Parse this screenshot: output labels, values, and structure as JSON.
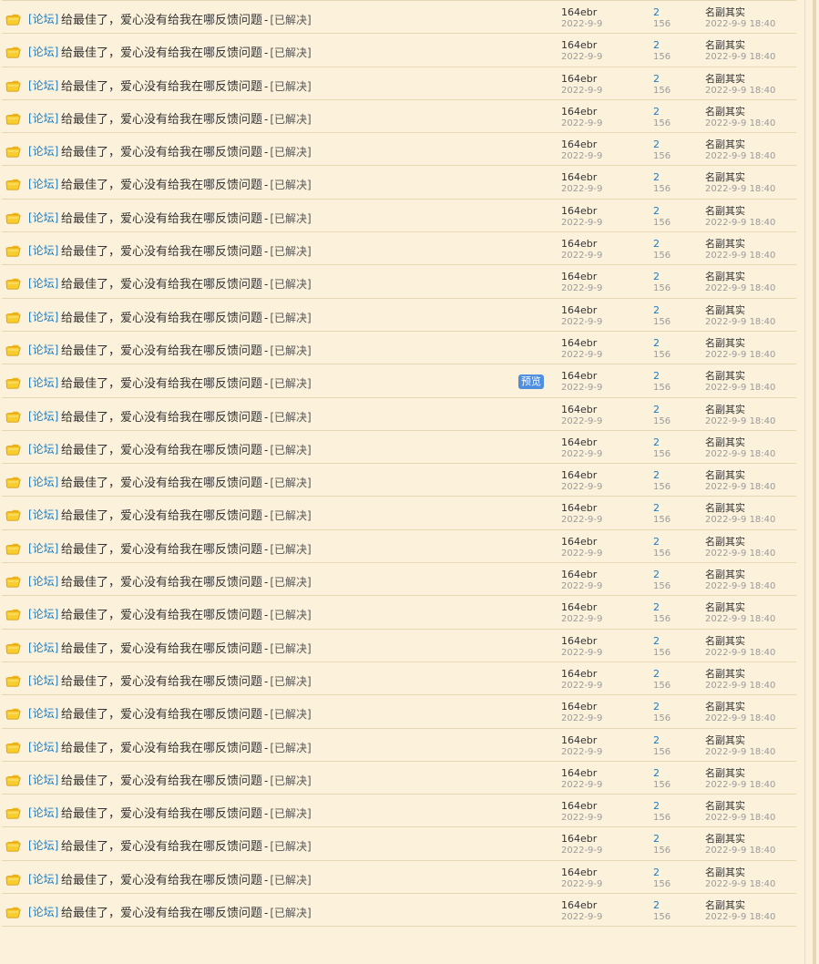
{
  "rows": [
    {
      "forum": "[论坛]",
      "title": "给最佳了，爱心没有给我在哪反馈问题",
      "sep": "-",
      "status": "[已解决]",
      "author": "164ebr",
      "post_date": "2022-9-9",
      "replies": "2",
      "views": "156",
      "last_poster": "名副其实",
      "last_time": "2022-9-9 18:40"
    },
    {
      "forum": "[论坛]",
      "title": "给最佳了，爱心没有给我在哪反馈问题",
      "sep": "-",
      "status": "[已解决]",
      "author": "164ebr",
      "post_date": "2022-9-9",
      "replies": "2",
      "views": "156",
      "last_poster": "名副其实",
      "last_time": "2022-9-9 18:40"
    },
    {
      "forum": "[论坛]",
      "title": "给最佳了，爱心没有给我在哪反馈问题",
      "sep": "-",
      "status": "[已解决]",
      "author": "164ebr",
      "post_date": "2022-9-9",
      "replies": "2",
      "views": "156",
      "last_poster": "名副其实",
      "last_time": "2022-9-9 18:40"
    },
    {
      "forum": "[论坛]",
      "title": "给最佳了，爱心没有给我在哪反馈问题",
      "sep": "-",
      "status": "[已解决]",
      "author": "164ebr",
      "post_date": "2022-9-9",
      "replies": "2",
      "views": "156",
      "last_poster": "名副其实",
      "last_time": "2022-9-9 18:40"
    },
    {
      "forum": "[论坛]",
      "title": "给最佳了，爱心没有给我在哪反馈问题",
      "sep": "-",
      "status": "[已解决]",
      "author": "164ebr",
      "post_date": "2022-9-9",
      "replies": "2",
      "views": "156",
      "last_poster": "名副其实",
      "last_time": "2022-9-9 18:40"
    },
    {
      "forum": "[论坛]",
      "title": "给最佳了，爱心没有给我在哪反馈问题",
      "sep": "-",
      "status": "[已解决]",
      "author": "164ebr",
      "post_date": "2022-9-9",
      "replies": "2",
      "views": "156",
      "last_poster": "名副其实",
      "last_time": "2022-9-9 18:40"
    },
    {
      "forum": "[论坛]",
      "title": "给最佳了，爱心没有给我在哪反馈问题",
      "sep": "-",
      "status": "[已解决]",
      "author": "164ebr",
      "post_date": "2022-9-9",
      "replies": "2",
      "views": "156",
      "last_poster": "名副其实",
      "last_time": "2022-9-9 18:40"
    },
    {
      "forum": "[论坛]",
      "title": "给最佳了，爱心没有给我在哪反馈问题",
      "sep": "-",
      "status": "[已解决]",
      "author": "164ebr",
      "post_date": "2022-9-9",
      "replies": "2",
      "views": "156",
      "last_poster": "名副其实",
      "last_time": "2022-9-9 18:40"
    },
    {
      "forum": "[论坛]",
      "title": "给最佳了，爱心没有给我在哪反馈问题",
      "sep": "-",
      "status": "[已解决]",
      "author": "164ebr",
      "post_date": "2022-9-9",
      "replies": "2",
      "views": "156",
      "last_poster": "名副其实",
      "last_time": "2022-9-9 18:40"
    },
    {
      "forum": "[论坛]",
      "title": "给最佳了，爱心没有给我在哪反馈问题",
      "sep": "-",
      "status": "[已解决]",
      "author": "164ebr",
      "post_date": "2022-9-9",
      "replies": "2",
      "views": "156",
      "last_poster": "名副其实",
      "last_time": "2022-9-9 18:40"
    },
    {
      "forum": "[论坛]",
      "title": "给最佳了，爱心没有给我在哪反馈问题",
      "sep": "-",
      "status": "[已解决]",
      "author": "164ebr",
      "post_date": "2022-9-9",
      "replies": "2",
      "views": "156",
      "last_poster": "名副其实",
      "last_time": "2022-9-9 18:40"
    },
    {
      "forum": "[论坛]",
      "title": "给最佳了，爱心没有给我在哪反馈问题",
      "sep": "-",
      "status": "[已解决]",
      "preview": "预览",
      "author": "164ebr",
      "post_date": "2022-9-9",
      "replies": "2",
      "views": "156",
      "last_poster": "名副其实",
      "last_time": "2022-9-9 18:40"
    },
    {
      "forum": "[论坛]",
      "title": "给最佳了，爱心没有给我在哪反馈问题",
      "sep": "-",
      "status": "[已解决]",
      "author": "164ebr",
      "post_date": "2022-9-9",
      "replies": "2",
      "views": "156",
      "last_poster": "名副其实",
      "last_time": "2022-9-9 18:40"
    },
    {
      "forum": "[论坛]",
      "title": "给最佳了，爱心没有给我在哪反馈问题",
      "sep": "-",
      "status": "[已解决]",
      "author": "164ebr",
      "post_date": "2022-9-9",
      "replies": "2",
      "views": "156",
      "last_poster": "名副其实",
      "last_time": "2022-9-9 18:40"
    },
    {
      "forum": "[论坛]",
      "title": "给最佳了，爱心没有给我在哪反馈问题",
      "sep": "-",
      "status": "[已解决]",
      "author": "164ebr",
      "post_date": "2022-9-9",
      "replies": "2",
      "views": "156",
      "last_poster": "名副其实",
      "last_time": "2022-9-9 18:40"
    },
    {
      "forum": "[论坛]",
      "title": "给最佳了，爱心没有给我在哪反馈问题",
      "sep": "-",
      "status": "[已解决]",
      "author": "164ebr",
      "post_date": "2022-9-9",
      "replies": "2",
      "views": "156",
      "last_poster": "名副其实",
      "last_time": "2022-9-9 18:40"
    },
    {
      "forum": "[论坛]",
      "title": "给最佳了，爱心没有给我在哪反馈问题",
      "sep": "-",
      "status": "[已解决]",
      "author": "164ebr",
      "post_date": "2022-9-9",
      "replies": "2",
      "views": "156",
      "last_poster": "名副其实",
      "last_time": "2022-9-9 18:40"
    },
    {
      "forum": "[论坛]",
      "title": "给最佳了，爱心没有给我在哪反馈问题",
      "sep": "-",
      "status": "[已解决]",
      "author": "164ebr",
      "post_date": "2022-9-9",
      "replies": "2",
      "views": "156",
      "last_poster": "名副其实",
      "last_time": "2022-9-9 18:40"
    },
    {
      "forum": "[论坛]",
      "title": "给最佳了，爱心没有给我在哪反馈问题",
      "sep": "-",
      "status": "[已解决]",
      "author": "164ebr",
      "post_date": "2022-9-9",
      "replies": "2",
      "views": "156",
      "last_poster": "名副其实",
      "last_time": "2022-9-9 18:40"
    },
    {
      "forum": "[论坛]",
      "title": "给最佳了，爱心没有给我在哪反馈问题",
      "sep": "-",
      "status": "[已解决]",
      "author": "164ebr",
      "post_date": "2022-9-9",
      "replies": "2",
      "views": "156",
      "last_poster": "名副其实",
      "last_time": "2022-9-9 18:40"
    },
    {
      "forum": "[论坛]",
      "title": "给最佳了，爱心没有给我在哪反馈问题",
      "sep": "-",
      "status": "[已解决]",
      "author": "164ebr",
      "post_date": "2022-9-9",
      "replies": "2",
      "views": "156",
      "last_poster": "名副其实",
      "last_time": "2022-9-9 18:40"
    },
    {
      "forum": "[论坛]",
      "title": "给最佳了，爱心没有给我在哪反馈问题",
      "sep": "-",
      "status": "[已解决]",
      "author": "164ebr",
      "post_date": "2022-9-9",
      "replies": "2",
      "views": "156",
      "last_poster": "名副其实",
      "last_time": "2022-9-9 18:40"
    },
    {
      "forum": "[论坛]",
      "title": "给最佳了，爱心没有给我在哪反馈问题",
      "sep": "-",
      "status": "[已解决]",
      "author": "164ebr",
      "post_date": "2022-9-9",
      "replies": "2",
      "views": "156",
      "last_poster": "名副其实",
      "last_time": "2022-9-9 18:40"
    },
    {
      "forum": "[论坛]",
      "title": "给最佳了，爱心没有给我在哪反馈问题",
      "sep": "-",
      "status": "[已解决]",
      "author": "164ebr",
      "post_date": "2022-9-9",
      "replies": "2",
      "views": "156",
      "last_poster": "名副其实",
      "last_time": "2022-9-9 18:40"
    },
    {
      "forum": "[论坛]",
      "title": "给最佳了，爱心没有给我在哪反馈问题",
      "sep": "-",
      "status": "[已解决]",
      "author": "164ebr",
      "post_date": "2022-9-9",
      "replies": "2",
      "views": "156",
      "last_poster": "名副其实",
      "last_time": "2022-9-9 18:40"
    },
    {
      "forum": "[论坛]",
      "title": "给最佳了，爱心没有给我在哪反馈问题",
      "sep": "-",
      "status": "[已解决]",
      "author": "164ebr",
      "post_date": "2022-9-9",
      "replies": "2",
      "views": "156",
      "last_poster": "名副其实",
      "last_time": "2022-9-9 18:40"
    },
    {
      "forum": "[论坛]",
      "title": "给最佳了，爱心没有给我在哪反馈问题",
      "sep": "-",
      "status": "[已解决]",
      "author": "164ebr",
      "post_date": "2022-9-9",
      "replies": "2",
      "views": "156",
      "last_poster": "名副其实",
      "last_time": "2022-9-9 18:40"
    },
    {
      "forum": "[论坛]",
      "title": "给最佳了，爱心没有给我在哪反馈问题",
      "sep": "-",
      "status": "[已解决]",
      "author": "164ebr",
      "post_date": "2022-9-9",
      "replies": "2",
      "views": "156",
      "last_poster": "名副其实",
      "last_time": "2022-9-9 18:40"
    }
  ],
  "icon": "folder-thread-icon",
  "colors": {
    "background": "#fcf2dc",
    "link": "#1f7bbd",
    "divider": "#e7d7b0",
    "preview_badge": "#4f8ee0"
  }
}
